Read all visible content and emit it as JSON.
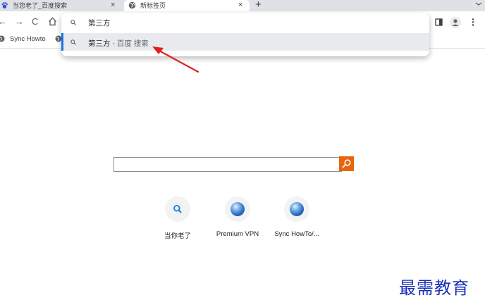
{
  "tabs": [
    {
      "title": "当您老了_百度搜索",
      "close": "×"
    },
    {
      "title": "新标签页",
      "close": "×"
    }
  ],
  "new_tab": "+",
  "toolbar": {
    "back": "←",
    "forward": "→",
    "reload": "C",
    "home_icon": "home-icon"
  },
  "omnibox": {
    "input_value": "第三方",
    "suggestion": {
      "term": "第三方",
      "suffix": " - 百度 搜索"
    }
  },
  "bookmarks": [
    {
      "label": "Sync Howto",
      "icon": "globe-icon"
    }
  ],
  "page": {
    "search_value": "",
    "shortcuts": [
      {
        "label": "当你老了",
        "icon": "search-icon"
      },
      {
        "label": "Premium VPN",
        "icon": "globe-icon"
      },
      {
        "label": "Sync HowTo/...",
        "icon": "globe-icon"
      }
    ]
  },
  "annotation": {
    "arrow_color": "#e02020"
  },
  "watermark": "最需教育",
  "colors": {
    "accent": "#1a73e8",
    "search_button": "#e8650e",
    "tabstrip": "#dee1e6"
  }
}
